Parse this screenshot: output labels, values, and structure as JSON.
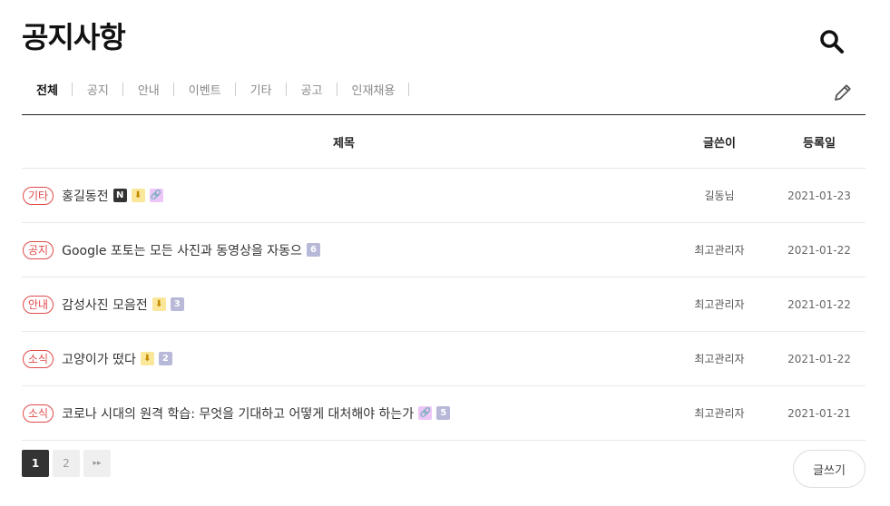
{
  "header": {
    "title": "공지사항"
  },
  "tabs": [
    {
      "label": "전체",
      "active": true
    },
    {
      "label": "공지",
      "active": false
    },
    {
      "label": "안내",
      "active": false
    },
    {
      "label": "이벤트",
      "active": false
    },
    {
      "label": "기타",
      "active": false
    },
    {
      "label": "공고",
      "active": false
    },
    {
      "label": "인재채용",
      "active": false
    }
  ],
  "table": {
    "headers": {
      "title": "제목",
      "writer": "글쓴이",
      "date": "등록일"
    },
    "rows": [
      {
        "category": "기타",
        "subject": "홍길동전",
        "badges": [
          {
            "type": "new",
            "text": "N"
          },
          {
            "type": "file",
            "text": "⬇"
          },
          {
            "type": "link",
            "text": "🔗"
          }
        ],
        "writer": "길동님",
        "date": "2021-01-23"
      },
      {
        "category": "공지",
        "subject": "Google 포토는 모든 사진과 동영상을 자동으",
        "badges": [
          {
            "type": "cnt",
            "text": "6"
          }
        ],
        "writer": "최고관리자",
        "date": "2021-01-22"
      },
      {
        "category": "안내",
        "subject": "감성사진 모음전",
        "badges": [
          {
            "type": "file",
            "text": "⬇"
          },
          {
            "type": "cnt",
            "text": "3"
          }
        ],
        "writer": "최고관리자",
        "date": "2021-01-22"
      },
      {
        "category": "소식",
        "subject": "고양이가 떴다",
        "badges": [
          {
            "type": "file",
            "text": "⬇"
          },
          {
            "type": "cnt",
            "text": "2"
          }
        ],
        "writer": "최고관리자",
        "date": "2021-01-22"
      },
      {
        "category": "소식",
        "subject": "코로나 시대의 원격 학습: 무엇을 기대하고 어떻게 대처해야 하는가",
        "badges": [
          {
            "type": "link",
            "text": "🔗"
          },
          {
            "type": "cnt",
            "text": "5"
          }
        ],
        "writer": "최고관리자",
        "date": "2021-01-21"
      }
    ]
  },
  "pagination": {
    "pages": [
      "1",
      "2"
    ],
    "current": "1",
    "next_icon": "▸▸"
  },
  "actions": {
    "write_label": "글쓰기"
  },
  "icons": {
    "search": "search-icon",
    "write": "pencil-icon"
  },
  "colors": {
    "category": "#e04a4a",
    "file_badge": "#fbe79a",
    "link_badge": "#ecc6f7",
    "count_badge": "#b8b8d8"
  }
}
